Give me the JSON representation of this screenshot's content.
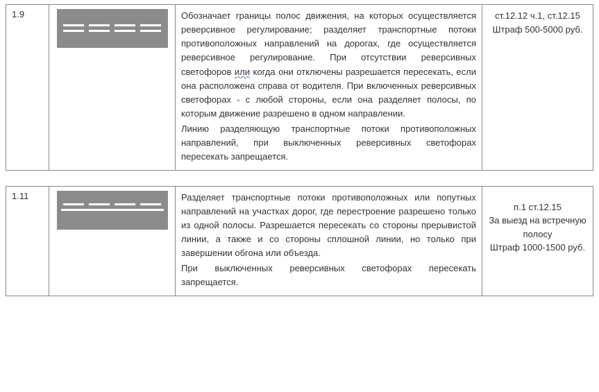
{
  "rows": [
    {
      "num": "1.9",
      "sign_type": "double-dashed",
      "desc": {
        "p1a": "Обозначает границы полос движения, на которых осуществляется реверсивное регулирование; разделяет транспортные потоки противоположных направлений на дорогах, где осуществляется реверсивное регулирование. При отсутствии реверсивных светофоров ",
        "p1u": "или",
        "p1b": " когда они отключены разрешается пересекать, если она расположена справа от водителя. При включенных реверсивных светофорах - с любой стороны, если она разделяет полосы, по которым движение разрешено в одном направлении.",
        "p2": "Линию разделяющую транспортные потоки противоположных направлений, при выключенных реверсивных светофорах пересекать запрещается."
      },
      "law": {
        "l1": "ст.12.12 ч.1, ст.12.15",
        "l2": "Штраф 500-5000 руб.",
        "l3": "",
        "l4": ""
      }
    },
    {
      "num": "1.11",
      "sign_type": "dashed-solid",
      "desc": {
        "p1a": "Разделяет транспортные потоки противоположных или попутных направлений на участках дорог, где перестроение разрешено только из одной полосы. Разрешается пересекать со стороны прерывистой линии, а также и со стороны сплошной линии, но только при завершении обгона или объезда.",
        "p1u": "",
        "p1b": "",
        "p2": "При выключенных реверсивных светофорах пересекать запрещается."
      },
      "law": {
        "l1": "п.1 ст.12.15",
        "l2": "За выезд на встречную",
        "l3": "полосу",
        "l4": "Штраф 1000-1500 руб."
      }
    }
  ]
}
